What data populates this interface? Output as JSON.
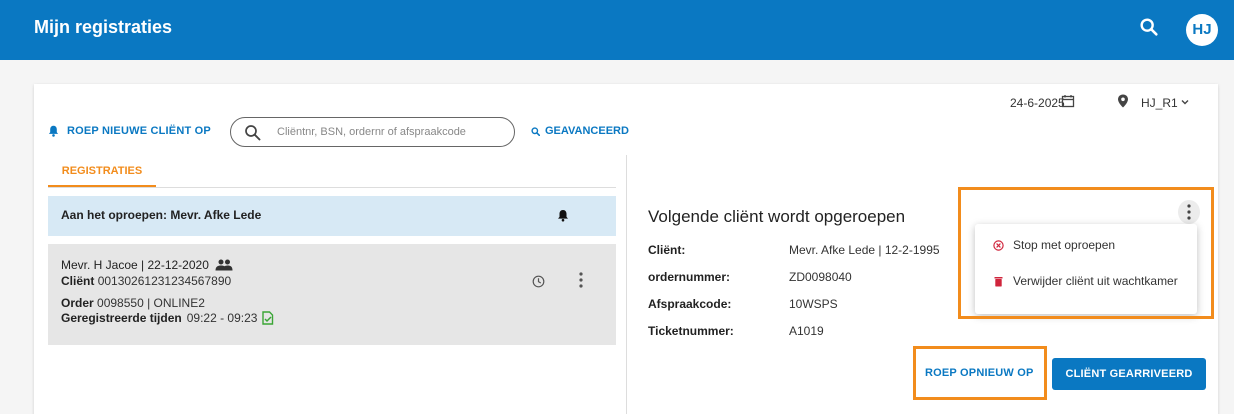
{
  "header": {
    "title": "Mijn registraties",
    "avatar_initials": "HJ",
    "search_icon": "search-icon"
  },
  "filters": {
    "date": "24-6-2025",
    "location": "HJ_R1"
  },
  "toolbar": {
    "call_new_label": "ROEP NIEUWE CLIËNT OP",
    "search_placeholder": "Cliëntnr, BSN, ordernr of afspraakcode",
    "advanced_label": "GEAVANCEERD"
  },
  "tabs": [
    {
      "label": "REGISTRATIES",
      "active": true
    }
  ],
  "calling_banner": {
    "text": "Aan het oproepen: Mevr. Afke Lede"
  },
  "registration": {
    "name_line": "Mevr. H Jacoe | 22-12-2020",
    "client_label": "Cliënt",
    "client_value": "00130261231234567890",
    "order_label": "Order",
    "order_value": "0098550 | ONLINE2",
    "times_label": "Geregistreerde tijden",
    "times_value": "09:22 - 09:23"
  },
  "detail": {
    "title": "Volgende cliënt wordt opgeroepen",
    "fields": [
      {
        "label": "Cliënt:",
        "value": "Mevr. Afke Lede | 12-2-1995"
      },
      {
        "label": "ordernummer:",
        "value": "ZD0098040"
      },
      {
        "label": "Afspraakcode:",
        "value": "10WSPS"
      },
      {
        "label": "Ticketnummer:",
        "value": "A1019"
      }
    ],
    "recall_label": "ROEP OPNIEUW OP",
    "arrived_label": "CLIËNT GEARRIVEERD"
  },
  "context_menu": {
    "items": [
      {
        "label": "Stop met oproepen",
        "icon": "cancel-circle-icon"
      },
      {
        "label": "Verwijder cliënt uit wachtkamer",
        "icon": "trash-icon"
      }
    ]
  },
  "colors": {
    "primary": "#0a78c2",
    "accent": "#f28c1c",
    "danger": "#d0253c",
    "banner": "#d7e9f5"
  }
}
